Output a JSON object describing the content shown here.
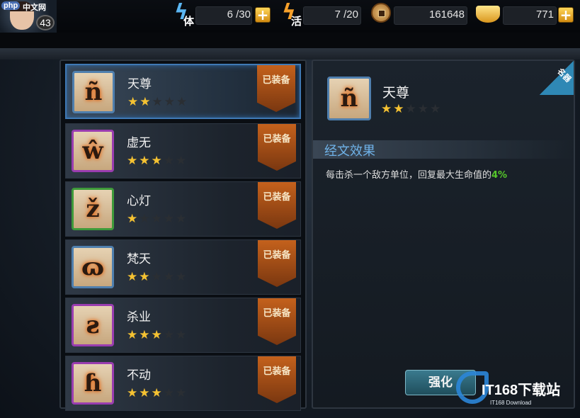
{
  "header": {
    "player_level": "43",
    "site_logo": "php",
    "site_logo_cn": "中文网",
    "stamina": {
      "icon": "lightning-icon",
      "label": "体",
      "value": "6 /30"
    },
    "vitality": {
      "icon": "lightning-icon",
      "label": "活",
      "value": "7 /20"
    },
    "copper": {
      "icon": "copper-coin-icon",
      "value": "161648"
    },
    "gold": {
      "icon": "gold-ingot-icon",
      "value": "771"
    },
    "plus_label": "+"
  },
  "scripture_list": {
    "equipped_label": "已装备",
    "items": [
      {
        "name": "天尊",
        "glyph": "ñ",
        "stars": 2,
        "max_stars": 5,
        "frame_color": "#4f7fae"
      },
      {
        "name": "虚无",
        "glyph": "ŵ",
        "stars": 3,
        "max_stars": 5,
        "frame_color": "#9a3db0"
      },
      {
        "name": "心灯",
        "glyph": "ž",
        "stars": 1,
        "max_stars": 5,
        "frame_color": "#3e9a3a"
      },
      {
        "name": "梵天",
        "glyph": "ɷ",
        "stars": 2,
        "max_stars": 5,
        "frame_color": "#4f7fae"
      },
      {
        "name": "杀业",
        "glyph": "ƨ",
        "stars": 3,
        "max_stars": 5,
        "frame_color": "#9a3db0"
      },
      {
        "name": "不动",
        "glyph": "ɦ",
        "stars": 3,
        "max_stars": 5,
        "frame_color": "#9a3db0"
      }
    ]
  },
  "detail": {
    "name": "天尊",
    "glyph": "ñ",
    "stars": 2,
    "max_stars": 5,
    "corner_tag": "名器",
    "section_title": "经文效果",
    "effect_text": "每击杀一个敌方单位，回复最大生命值的",
    "effect_value": "4%",
    "enhance_button": "强化"
  },
  "watermark": {
    "main": "IT168下载站",
    "sub": "IT168 Download"
  },
  "colors": {
    "star_on": "#f5c232",
    "star_off": "#2a2e33",
    "highlight_green": "#56c82a",
    "section_blue": "#6fb2e8",
    "selected_border": "#3f79b5"
  }
}
